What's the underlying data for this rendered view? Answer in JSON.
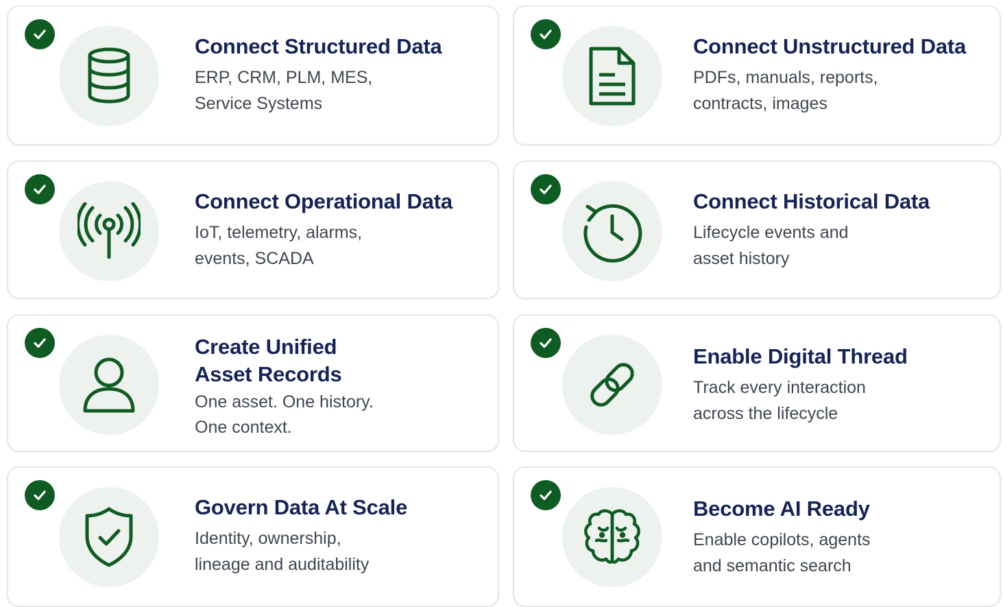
{
  "colors": {
    "accent_green": "#0f5c23",
    "title_navy": "#152357",
    "description_gray": "#3f4650",
    "icon_circle_bg": "#eef2ee",
    "card_border": "#e4e6ea"
  },
  "cards": [
    {
      "icon": "database-icon",
      "title_line1": "Connect Structured Data",
      "title_line2": "",
      "desc_line1": "ERP, CRM, PLM, MES,",
      "desc_line2": "Service Systems",
      "checked": true
    },
    {
      "icon": "document-icon",
      "title_line1": "Connect Unstructured Data",
      "title_line2": "",
      "desc_line1": "PDFs, manuals, reports,",
      "desc_line2": "contracts, images",
      "checked": true
    },
    {
      "icon": "antenna-signal-icon",
      "title_line1": "Connect Operational Data",
      "title_line2": "",
      "desc_line1": "IoT, telemetry, alarms,",
      "desc_line2": "events, SCADA",
      "checked": true
    },
    {
      "icon": "history-clock-icon",
      "title_line1": "Connect Historical Data",
      "title_line2": "",
      "desc_line1": "Lifecycle events and",
      "desc_line2": "asset history",
      "checked": true
    },
    {
      "icon": "user-icon",
      "title_line1": "Create Unified",
      "title_line2": "Asset Records",
      "desc_line1": "One asset. One history.",
      "desc_line2": "One context.",
      "checked": true
    },
    {
      "icon": "link-icon",
      "title_line1": "Enable Digital Thread",
      "title_line2": "",
      "desc_line1": "Track every interaction",
      "desc_line2": "across the lifecycle",
      "checked": true
    },
    {
      "icon": "shield-check-icon",
      "title_line1": "Govern Data At Scale",
      "title_line2": "",
      "desc_line1": "Identity, ownership,",
      "desc_line2": "lineage and auditability",
      "checked": true
    },
    {
      "icon": "brain-icon",
      "title_line1": "Become AI Ready",
      "title_line2": "",
      "desc_line1": "Enable copilots, agents",
      "desc_line2": "and semantic search",
      "checked": true
    }
  ]
}
